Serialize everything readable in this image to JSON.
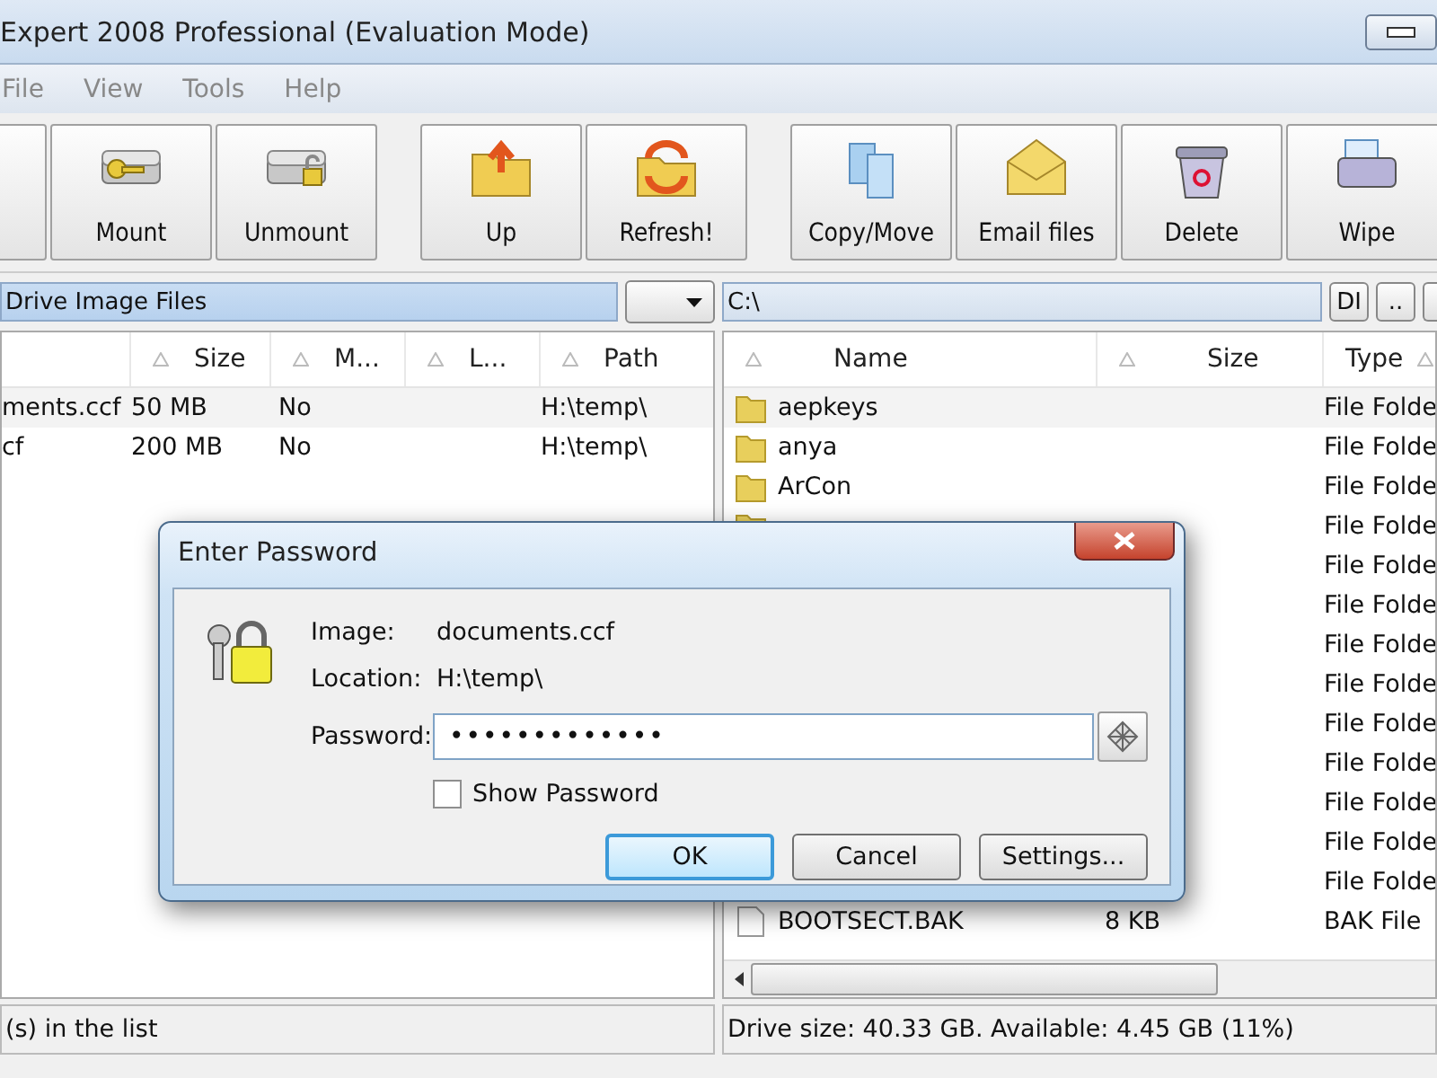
{
  "window": {
    "title": "Expert 2008 Professional (Evaluation Mode)"
  },
  "menu": [
    "File",
    "View",
    "Tools",
    "Help"
  ],
  "toolbar": [
    {
      "kind": "mount",
      "label": "Mount"
    },
    {
      "kind": "unmount",
      "label": "Unmount"
    },
    {
      "kind": "up",
      "label": "Up"
    },
    {
      "kind": "refresh",
      "label": "Refresh!"
    },
    {
      "kind": "copy",
      "label": "Copy/Move"
    },
    {
      "kind": "email",
      "label": "Email files"
    },
    {
      "kind": "delete",
      "label": "Delete"
    },
    {
      "kind": "wipe",
      "label": "Wipe"
    }
  ],
  "left_panel": {
    "location": "Drive Image Files",
    "columns": [
      "Size",
      "M...",
      "L...",
      "Path"
    ],
    "rows": [
      {
        "column_1": "ments.ccf",
        "size": "50 MB",
        "m": "No",
        "path": "H:\\temp\\"
      },
      {
        "column_1": "cf",
        "size": "200 MB",
        "m": "No",
        "path": "H:\\temp\\"
      }
    ]
  },
  "right_panel": {
    "location": "C:\\",
    "buttons": [
      "DI",
      ".."
    ],
    "columns": [
      "Name",
      "Size",
      "Type"
    ],
    "rows": [
      {
        "kind": "folder",
        "name": "aepkeys",
        "type": "File Folde"
      },
      {
        "kind": "folder",
        "name": "anya",
        "type": "File Folde"
      },
      {
        "kind": "folder",
        "name": "ArCon",
        "type": "File Folde"
      },
      {
        "kind": "folder",
        "type": "File Folde"
      },
      {
        "kind": "folder",
        "type": "File Folde"
      },
      {
        "kind": "folder",
        "type": "File Folde"
      },
      {
        "kind": "folder",
        "type": "File Folde"
      },
      {
        "kind": "folder",
        "type": "File Folde"
      },
      {
        "kind": "folder",
        "type": "File Folde"
      },
      {
        "kind": "folder",
        "type": "File Folde"
      },
      {
        "kind": "folder",
        "type": "File Folde"
      },
      {
        "kind": "folder",
        "type": "File Folde"
      },
      {
        "kind": "folder",
        "type": "File Folde"
      },
      {
        "kind": "file",
        "name": "BOOTSECT.BAK",
        "size": "8 KB",
        "type": "BAK File"
      }
    ]
  },
  "status_bar": {
    "left": "(s) in the list",
    "right": "Drive size: 40.33 GB. Available: 4.45 GB (11%)"
  },
  "dialog": {
    "title": "Enter Password",
    "image_label": "Image:",
    "image": "documents.ccf",
    "location_label": "Location:",
    "location": "H:\\temp\\",
    "password_label": "Password:",
    "password": "•••••••••••••",
    "show_password": {
      "label": "Show Password",
      "checked": false
    },
    "buttons": [
      {
        "label": "OK",
        "selected": true
      },
      {
        "label": "Cancel",
        "selected": false
      },
      {
        "label": "Settings...",
        "selected": false
      }
    ]
  }
}
